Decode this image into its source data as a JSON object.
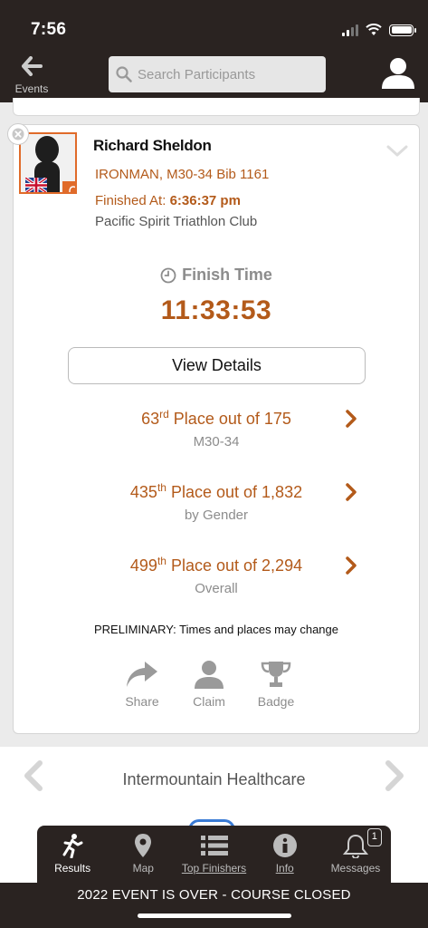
{
  "status_bar": {
    "time": "7:56"
  },
  "header": {
    "back_label": "Events",
    "search_placeholder": "Search Participants"
  },
  "athlete": {
    "name": "Richard Sheldon",
    "division_line": "IRONMAN, M30-34 Bib 1161",
    "finished_label": "Finished At:",
    "finished_time": "6:36:37 pm",
    "club": "Pacific Spirit Triathlon Club",
    "finish_time_label": "Finish Time",
    "finish_time": "11:33:53",
    "view_details_label": "View Details"
  },
  "places": [
    {
      "rank": "63",
      "suffix": "rd",
      "text": "Place out of 175",
      "sub": "M30-34"
    },
    {
      "rank": "435",
      "suffix": "th",
      "text": "Place out of 1,832",
      "sub": "by Gender"
    },
    {
      "rank": "499",
      "suffix": "th",
      "text": "Place out of 2,294",
      "sub": "Overall"
    }
  ],
  "preliminary_note": "PRELIMINARY: Times and places may change",
  "actions": [
    {
      "label": "Share",
      "icon": "share-icon"
    },
    {
      "label": "Claim",
      "icon": "person-icon"
    },
    {
      "label": "Badge",
      "icon": "trophy-icon"
    }
  ],
  "sponsor": {
    "name": "Intermountain Healthcare"
  },
  "tabs": [
    {
      "label": "Results",
      "icon": "runner-icon",
      "active": true
    },
    {
      "label": "Map",
      "icon": "map-pin-icon"
    },
    {
      "label": "Top Finishers",
      "icon": "list-icon"
    },
    {
      "label": "Info",
      "icon": "info-icon"
    },
    {
      "label": "Messages",
      "icon": "bell-icon",
      "badge": "1"
    }
  ],
  "event_status": "2022 EVENT IS OVER - COURSE CLOSED",
  "colors": {
    "accent": "#b35a1a",
    "header_bg": "#2a2321",
    "avatar_border": "#e06b2a"
  }
}
